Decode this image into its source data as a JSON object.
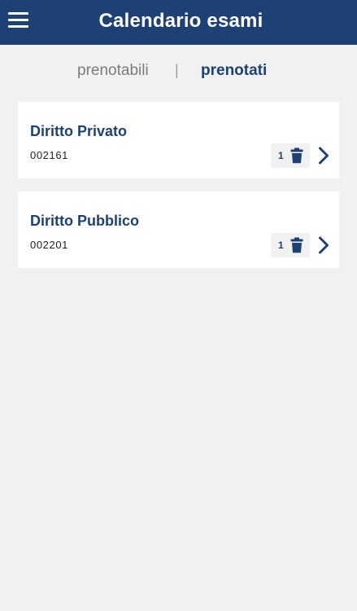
{
  "header": {
    "title": "Calendario esami",
    "menu_icon": "hamburger-menu-icon",
    "background_color": "#1d4175"
  },
  "tabs": {
    "items": [
      {
        "label": "prenotabili",
        "active": false
      },
      {
        "label": "prenotati",
        "active": true
      }
    ],
    "separator": "|"
  },
  "exams": [
    {
      "title": "Diritto Privato",
      "code": "002161",
      "count": "1",
      "delete_icon": "trash-icon",
      "open_icon": "chevron-right-icon"
    },
    {
      "title": "Diritto Pubblico",
      "code": "002201",
      "count": "1",
      "delete_icon": "trash-icon",
      "open_icon": "chevron-right-icon"
    }
  ],
  "colors": {
    "accent": "#1d4175",
    "background": "#f1f1f1",
    "card": "#ffffff",
    "inactive_tab": "#7b7b7b"
  }
}
